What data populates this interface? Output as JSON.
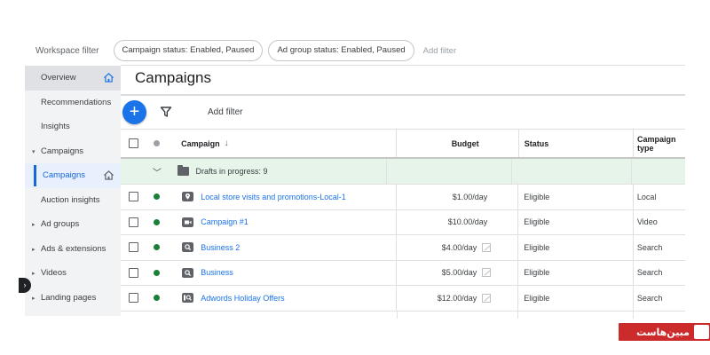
{
  "workspace_filter": {
    "label": "Workspace filter",
    "chips": [
      "Campaign status: Enabled, Paused",
      "Ad group status: Enabled, Paused"
    ],
    "add_filter": "Add filter"
  },
  "sidebar": {
    "items": [
      {
        "label": "Overview"
      },
      {
        "label": "Recommendations"
      },
      {
        "label": "Insights"
      },
      {
        "label": "Campaigns"
      },
      {
        "label": "Campaigns"
      },
      {
        "label": "Auction insights"
      },
      {
        "label": "Ad groups"
      },
      {
        "label": "Ads & extensions"
      },
      {
        "label": "Videos"
      },
      {
        "label": "Landing pages"
      }
    ]
  },
  "main": {
    "title": "Campaigns",
    "add_filter": "Add filter"
  },
  "table": {
    "headers": {
      "campaign": "Campaign",
      "budget": "Budget",
      "status": "Status",
      "type_line1": "Campaign",
      "type_line2": "type"
    },
    "drafts": "Drafts in progress: 9",
    "rows": [
      {
        "name": "Local store visits and promotions-Local-1",
        "budget": "$1.00/day",
        "status": "Eligible",
        "type": "Local",
        "icon": "location-pin-icon"
      },
      {
        "name": "Campaign #1",
        "budget": "$10.00/day",
        "status": "Eligible",
        "type": "Video",
        "icon": "video-icon"
      },
      {
        "name": "Business 2",
        "budget": "$4.00/day",
        "status": "Eligible",
        "type": "Search",
        "icon": "search-icon"
      },
      {
        "name": "Business",
        "budget": "$5.00/day",
        "status": "Eligible",
        "type": "Search",
        "icon": "search-icon"
      },
      {
        "name": "Adwords Holiday Offers",
        "budget": "$12.00/day",
        "status": "Eligible",
        "type": "Search",
        "icon": "search-icon"
      }
    ]
  },
  "watermark": {
    "text": "مبین‌هاست"
  },
  "colors": {
    "accent": "#1a73e8",
    "active_text": "#1967d2",
    "enabled_dot": "#188038",
    "drafts_row_bg": "#e6f4ea",
    "watermark_bg": "#cc2b2b"
  }
}
